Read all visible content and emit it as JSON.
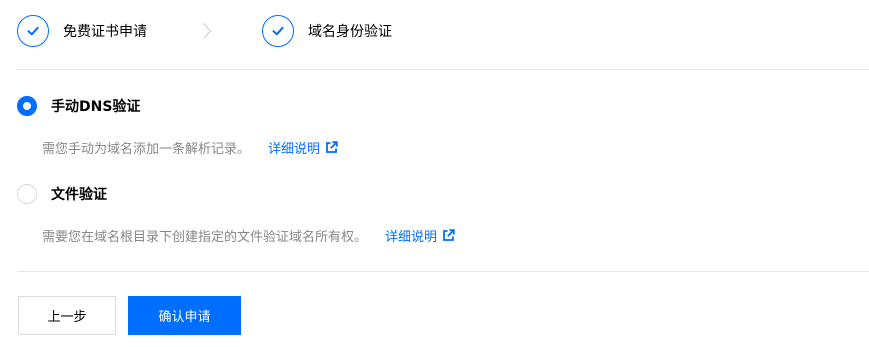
{
  "steps": [
    {
      "label": "免费证书申请",
      "status": "done"
    },
    {
      "label": "域名身份验证",
      "status": "done"
    }
  ],
  "options": {
    "dns": {
      "title": "手动DNS验证",
      "description": "需您手动为域名添加一条解析记录。",
      "link_label": "详细说明",
      "selected": true
    },
    "file": {
      "title": "文件验证",
      "description": "需要您在域名根目录下创建指定的文件验证域名所有权。",
      "link_label": "详细说明",
      "selected": false
    }
  },
  "buttons": {
    "prev_label": "上一步",
    "confirm_label": "确认申请"
  },
  "colors": {
    "accent": "#006eff",
    "muted_text": "#888888",
    "divider": "#e5e5e5"
  },
  "icons": {
    "step_done": "check-icon",
    "step_separator": "chevron-right-icon",
    "link": "external-link-icon"
  }
}
